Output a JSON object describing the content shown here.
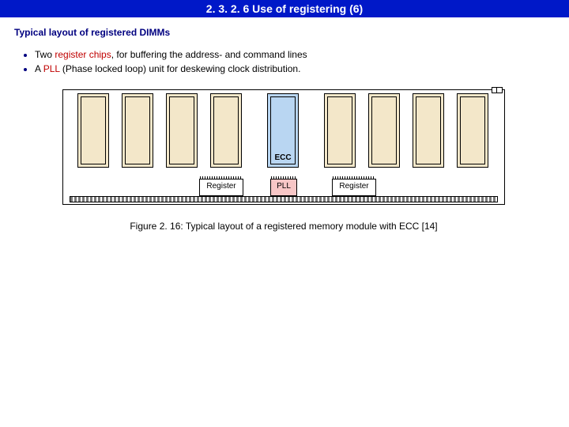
{
  "title": "2. 3. 2. 6  Use of registering (6)",
  "subhead": "Typical layout of registered DIMMs",
  "bullet1_pre": "Two ",
  "bullet1_red": "register chips",
  "bullet1_post": ", for buffering the address- and command lines",
  "bullet2_pre": "A ",
  "bullet2_red": "PLL",
  "bullet2_post": " (Phase locked loop) unit for deskewing clock distribution.",
  "ecc_label": "ECC",
  "reg_label": "Register",
  "pll_label": "PLL",
  "caption": "Figure 2. 16: Typical layout of a registered memory module with ECC [14]"
}
